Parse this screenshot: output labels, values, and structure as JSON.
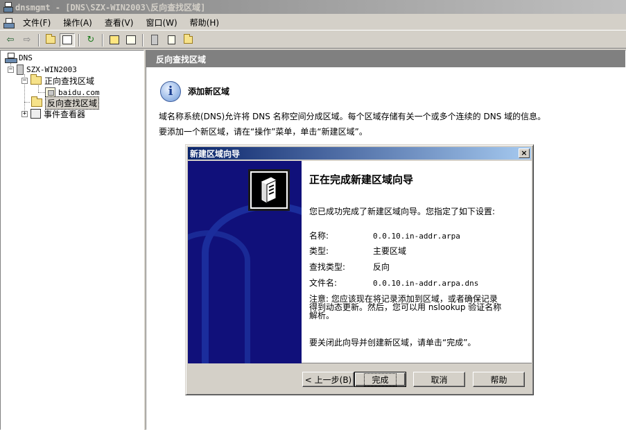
{
  "window": {
    "title": "dnsmgmt - [DNS\\SZX-WIN2003\\反向查找区域]"
  },
  "menu": [
    "文件(F)",
    "操作(A)",
    "查看(V)",
    "窗口(W)",
    "帮助(H)"
  ],
  "toolbar": {
    "icons": [
      "back-arrow-icon",
      "forward-arrow-icon",
      "up-folder-icon",
      "show-hide-tree-icon",
      "refresh-icon",
      "properties-icon",
      "export-list-icon",
      "server-list-icon",
      "log-icon",
      "event-icon"
    ]
  },
  "tree": {
    "root": "DNS",
    "server": "SZX-WIN2003",
    "forward_zone": "正向查找区域",
    "forward_child": "baidu.com",
    "reverse_zone": "反向查找区域",
    "event_viewer": "事件查看器"
  },
  "right_pane": {
    "header": "反向查找区域",
    "info_title": "添加新区域",
    "info_line1": "域名称系统(DNS)允许将 DNS 名称空间分成区域。每个区域存储有关一个或多个连续的 DNS 域的信息。",
    "info_line2": "要添加一个新区域，请在“操作”菜单，单击“新建区域”。"
  },
  "wizard": {
    "title": "新建区域向导",
    "close": "×",
    "heading": "正在完成新建区域向导",
    "intro": "您已成功完成了新建区域向导。您指定了如下设置:",
    "settings": [
      {
        "key": "名称:",
        "value": "0.0.10.in-addr.arpa"
      },
      {
        "key": "类型:",
        "value": "主要区域"
      },
      {
        "key": "查找类型:",
        "value": "反向"
      },
      {
        "key": "文件名:",
        "value": "0.0.10.in-addr.arpa.dns"
      }
    ],
    "note_line1": "注意: 您应该现在将记录添加到区域，或者确保记录",
    "note_line2": "得到动态更新。然后，您可以用 nslookup 验证名称",
    "note_line3": "解析。",
    "final": "要关闭此向导并创建新区域，请单击“完成”。",
    "buttons": {
      "back": "< 上一步(B)",
      "finish": "完成",
      "cancel": "取消",
      "help": "帮助"
    }
  }
}
